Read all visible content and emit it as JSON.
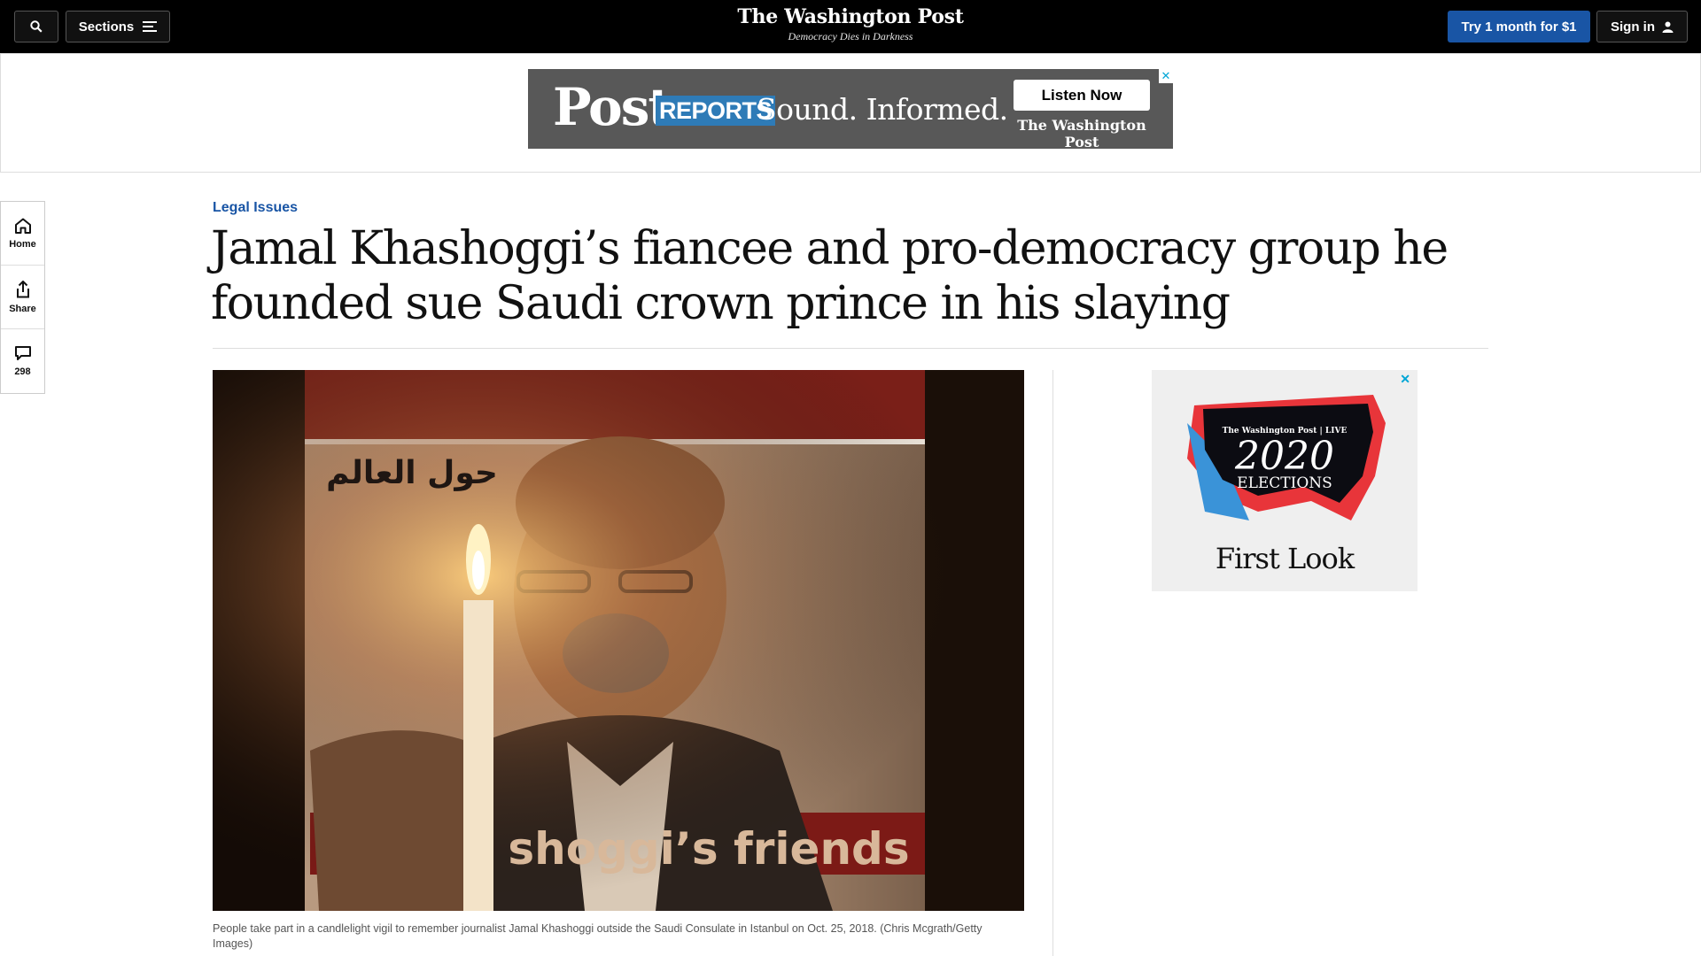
{
  "header": {
    "sections_label": "Sections",
    "logo": "The Washington Post",
    "tagline": "Democracy Dies in Darkness",
    "subscribe_label": "Try 1 month for $1",
    "signin_label": "Sign in"
  },
  "top_ad": {
    "brand_post": "Post",
    "brand_reports": "REPORTS",
    "slogan": "Sound. Informed.",
    "cta": "Listen Now",
    "publisher": "The Washington Post",
    "close": "✕"
  },
  "rail": {
    "home_label": "Home",
    "share_label": "Share",
    "comments_count": "298"
  },
  "article": {
    "kicker": "Legal Issues",
    "headline": "Jamal Khashoggi’s fiancee and pro-democracy group he founded sue Saudi crown prince in his slaying",
    "caption": "People take part in a candlelight vigil to remember journalist Jamal Khashoggi outside the Saudi Consulate in Istanbul on Oct. 25, 2018. (Chris Mcgrath/Getty Images)",
    "photo_text_arabic": "حول العالم",
    "photo_text_bottom": "shoggi’s friends"
  },
  "side_ad": {
    "brand": "The Washington Post | LIVE",
    "year": "2020",
    "elections": "ELECTIONS",
    "first_look": "First Look",
    "close": "✕"
  },
  "colors": {
    "accent_blue": "#1955a5",
    "topbar": "#000000"
  }
}
